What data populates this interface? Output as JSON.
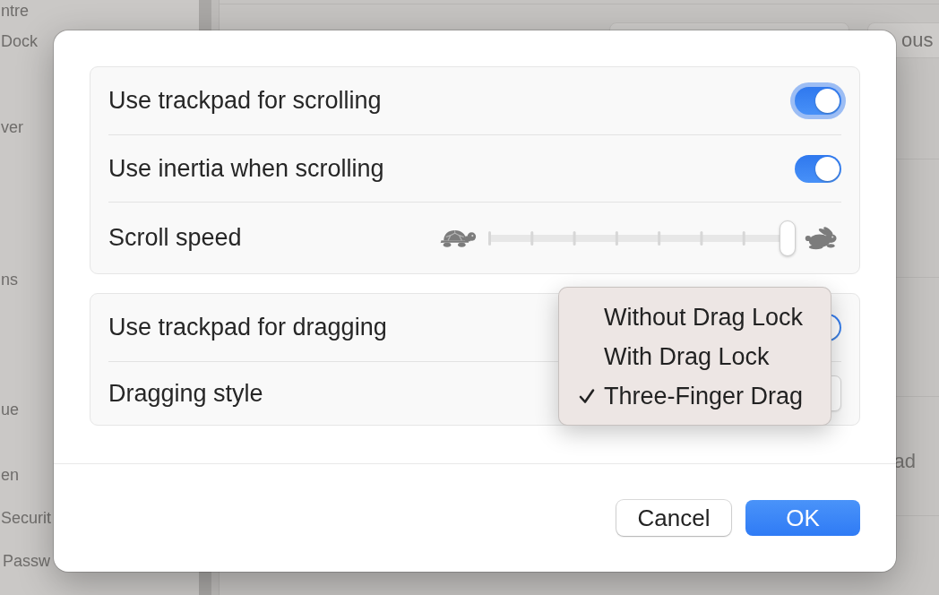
{
  "background": {
    "sidebar": {
      "items": [
        "ntre",
        "Dock",
        "ver",
        "ns",
        "ue",
        "en",
        "Securit",
        "Passw"
      ]
    },
    "toolbar": {
      "button": "ous"
    },
    "content": {
      "row_label": "ad"
    }
  },
  "dialog": {
    "groups": [
      {
        "rows": [
          {
            "kind": "toggle",
            "label": "Use trackpad for scrolling",
            "on": true,
            "focused": true
          },
          {
            "kind": "toggle",
            "label": "Use inertia when scrolling",
            "on": true,
            "focused": false
          },
          {
            "kind": "slider",
            "label": "Scroll speed",
            "level": 1
          }
        ]
      },
      {
        "rows": [
          {
            "kind": "toggle",
            "label": "Use trackpad for dragging",
            "on": true,
            "focused": false
          },
          {
            "kind": "popup",
            "label": "Dragging style"
          }
        ]
      }
    ],
    "popup_menu": {
      "items": [
        {
          "label": "Without Drag Lock",
          "selected": false
        },
        {
          "label": "With Drag Lock",
          "selected": false
        },
        {
          "label": "Three-Finger Drag",
          "selected": true
        }
      ]
    },
    "buttons": [
      {
        "kind": "secondary",
        "label": "Cancel"
      },
      {
        "kind": "primary",
        "label": "OK"
      }
    ]
  }
}
